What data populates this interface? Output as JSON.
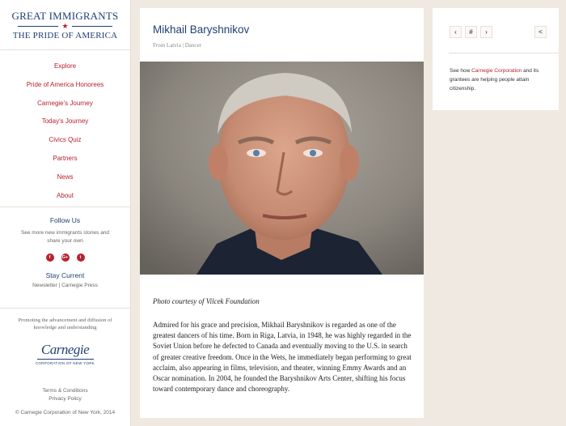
{
  "logo": {
    "line1": "GREAT IMMIGRANTS",
    "star": "★",
    "line2": "THE PRIDE OF AMERICA"
  },
  "nav": [
    "Explore",
    "Pride of America Honorees",
    "Carnegie's Journey",
    "Today's Journey",
    "Civics Quiz",
    "Partners",
    "News",
    "About"
  ],
  "follow": {
    "title": "Follow Us",
    "text": "See more new immigrants stories and share your own",
    "social": [
      "f",
      "G+",
      "t"
    ]
  },
  "stay": {
    "title": "Stay Current",
    "links": "Newsletter  |  Carnegie Press"
  },
  "mission": {
    "text": "Promoting the advancement and diffusion of knowledge and understanding",
    "signature": "Carnegie",
    "corp": "CORPORATION OF NEW YORK"
  },
  "legal": {
    "terms": "Terms & Conditions",
    "privacy": "Privacy Policy"
  },
  "copyright": "© Carnegie Corporation of New York, 2014",
  "profile": {
    "name": "Mikhail Baryshnikov",
    "subtitle": "From Latvia | Dancer",
    "caption": "Photo courtesy of Vilcek Foundation",
    "body": "Admired for his grace and precision, Mikhail Baryshnikov is regarded as one of the greatest dancers of his time. Born in Riga, Latvia, in 1948, he was highly regarded in the Soviet Union before he defected to Canada and eventually moving to the U.S. in search of greater creative freedom. Once in the Wets, he immediately began performing to great acclaim, also appearing in films, television, and theater, winning Emmy Awards and an Oscar nomination. In 2004, he founded the Baryshnikov Arts Center, shifting his focus toward contemporary dance and choreography."
  },
  "panel": {
    "prev": "‹",
    "grid": "#",
    "next": "›",
    "share": "<",
    "text_pre": "See how ",
    "link": "Carnegie Corporation",
    "text_post": " and its grantees are helping people attain citizenship."
  },
  "colors": {
    "brand_red": "#b8202e",
    "brand_blue": "#1f3f73",
    "background": "#efe9e1"
  }
}
